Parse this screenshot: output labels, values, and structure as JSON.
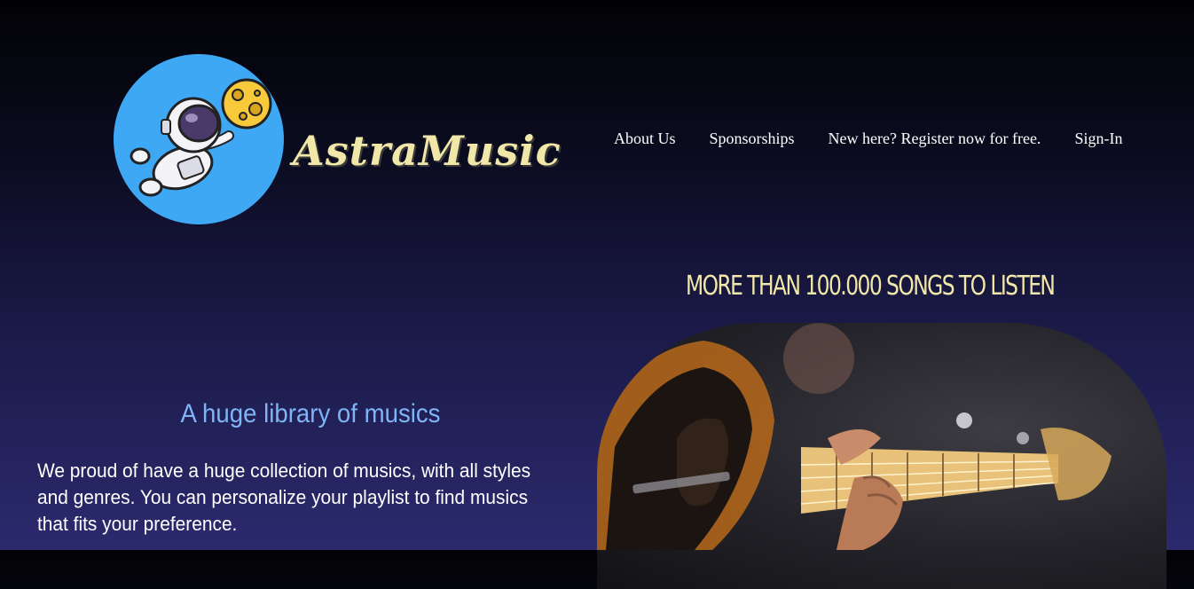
{
  "brand": {
    "name": "AstraMusic",
    "logo_color": "#3ea8f5",
    "text_color": "#f1e7a8"
  },
  "nav": {
    "items": [
      {
        "label": "About Us"
      },
      {
        "label": "Sponsorships"
      },
      {
        "label": "New here? Register now for free."
      },
      {
        "label": "Sign-In"
      }
    ]
  },
  "hero": {
    "headline": "MORE THAN 100.000 SONGS TO LISTEN",
    "image": "bass-guitar-photo"
  },
  "section": {
    "title": "A huge library of musics",
    "text": "We proud of have a huge collection of musics, with all styles and genres. You can personalize your playlist to find musics that fits your preference."
  },
  "colors": {
    "accent_yellow": "#f1e7a8",
    "accent_blue": "#7fb5f5"
  }
}
